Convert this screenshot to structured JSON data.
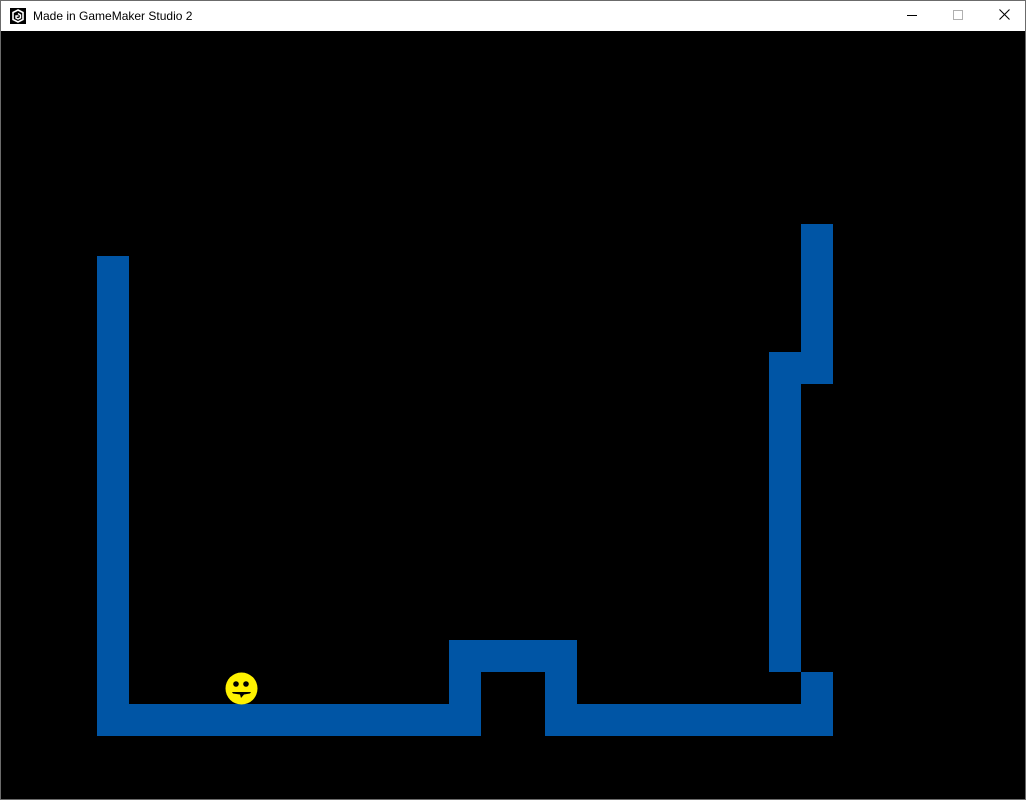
{
  "window": {
    "title": "Made in GameMaker Studio 2",
    "icon": "gamemaker-logo-icon",
    "controls": [
      "minimize-icon",
      "maximize-icon",
      "close-icon"
    ]
  },
  "game": {
    "background_color": "#000000",
    "wall_color": "#0055A5",
    "player": {
      "icon": "smiley-face-icon",
      "color": "#FFF200"
    }
  }
}
